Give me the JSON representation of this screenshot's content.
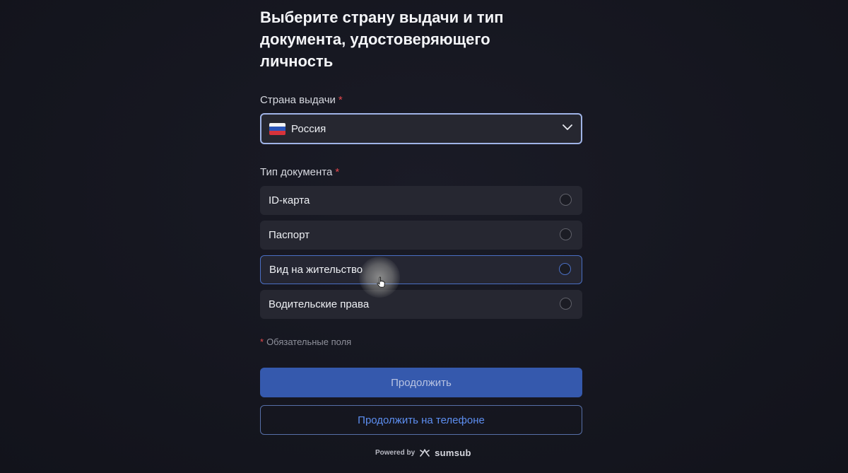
{
  "header": {
    "title": "Выберите страну выдачи и тип документа, удостоверяющего личность"
  },
  "country": {
    "label": "Страна выдачи",
    "required_mark": "*",
    "selected_value": "Россия",
    "flag_icon": "russia-flag-icon",
    "chevron_icon": "chevron-down-icon"
  },
  "doctype": {
    "label": "Тип документа",
    "required_mark": "*",
    "options": [
      {
        "label": "ID-карта"
      },
      {
        "label": "Паспорт"
      },
      {
        "label": "Вид на жительство"
      },
      {
        "label": "Водительские права"
      }
    ]
  },
  "required_note": {
    "mark": "*",
    "text": "Обязательные поля"
  },
  "actions": {
    "continue_label": "Продолжить",
    "continue_phone_label": "Продолжить на телефоне"
  },
  "footer": {
    "powered_by": "Powered by",
    "brand": "sumsub",
    "brand_icon": "sumsub-logo-icon"
  },
  "colors": {
    "background": "#151620",
    "accent": "#3559ad",
    "link": "#5d8ef0",
    "required": "#e5484d"
  }
}
